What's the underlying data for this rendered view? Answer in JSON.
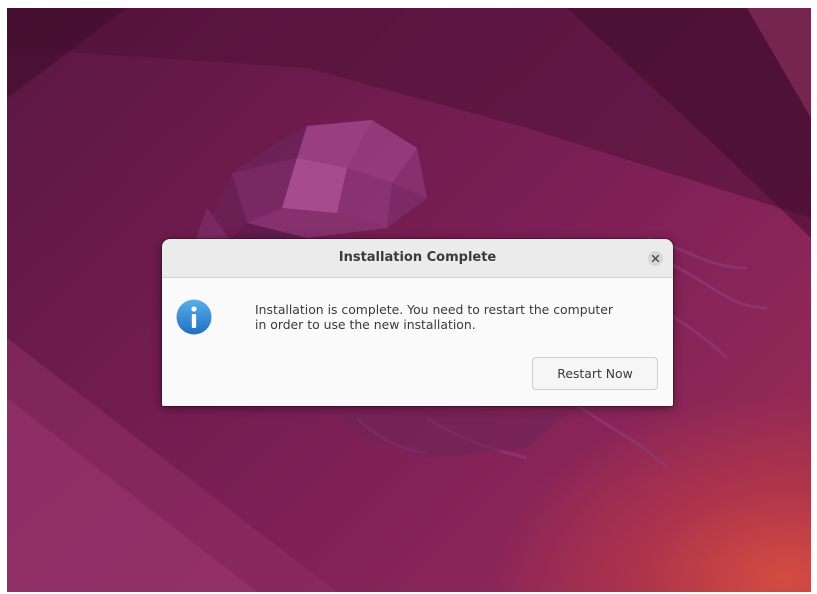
{
  "dialog": {
    "title": "Installation Complete",
    "message": "Installation is complete. You need to restart the computer\nin order to use the new installation.",
    "restart_label": "Restart Now",
    "close_icon": "close-icon",
    "info_icon": "info-icon"
  },
  "colors": {
    "wallpaper_dark": "#5a1640",
    "wallpaper_mid": "#7c1f56",
    "wallpaper_accent": "#d64e40",
    "info_blue": "#2a7fd4",
    "dialog_bg": "#fafafa",
    "titlebar_bg": "#ebebeb"
  }
}
